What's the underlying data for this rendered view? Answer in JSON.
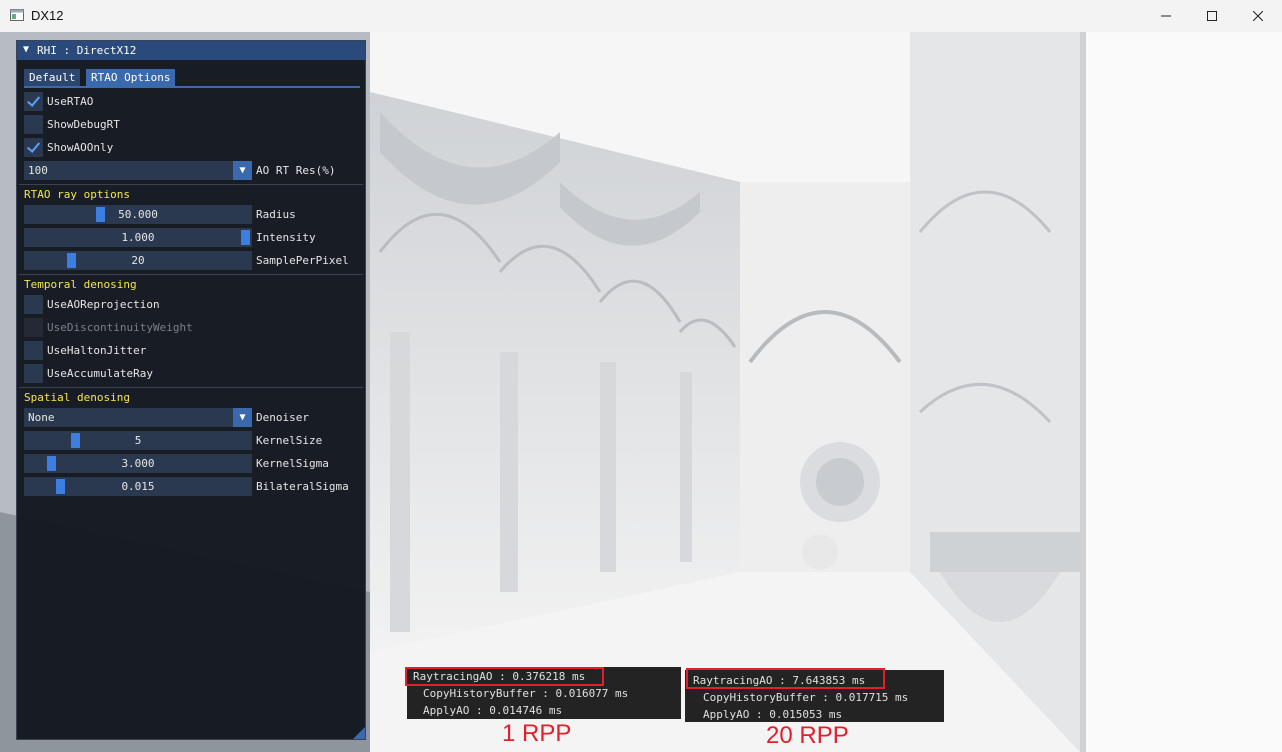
{
  "window": {
    "title": "DX12",
    "icon": "app-window-icon"
  },
  "panel": {
    "title": "RHI : DirectX12",
    "tabs": [
      "Default",
      "RTAO Options"
    ],
    "checkboxes_top": [
      {
        "label": "UseRTAO",
        "checked": true
      },
      {
        "label": "ShowDebugRT",
        "checked": false
      },
      {
        "label": "ShowAOOnly",
        "checked": true
      }
    ],
    "ao_res": {
      "value": "100",
      "label": "AO RT Res(%)"
    },
    "ray_section": "RTAO ray options",
    "ray_sliders": [
      {
        "value": "50.000",
        "label": "Radius",
        "fraction": 0.35
      },
      {
        "value": "1.000",
        "label": "Intensity",
        "fraction": 1.0
      },
      {
        "value": "20",
        "label": "SamplePerPixel",
        "fraction": 0.2
      }
    ],
    "temporal_section": "Temporal denosing",
    "temporal_checkboxes": [
      {
        "label": "UseAOReprojection",
        "checked": false,
        "disabled": false
      },
      {
        "label": "UseDiscontinuityWeight",
        "checked": false,
        "disabled": true
      },
      {
        "label": "UseHaltonJitter",
        "checked": false,
        "disabled": false
      },
      {
        "label": "UseAccumulateRay",
        "checked": false,
        "disabled": false
      }
    ],
    "spatial_section": "Spatial denosing",
    "denoiser": {
      "value": "None",
      "label": "Denoiser"
    },
    "spatial_sliders": [
      {
        "value": "5",
        "label": "KernelSize",
        "fraction": 0.23
      },
      {
        "value": "3.000",
        "label": "KernelSigma",
        "fraction": 0.1
      },
      {
        "value": "0.015",
        "label": "BilateralSigma",
        "fraction": 0.15
      }
    ]
  },
  "profiler_left": {
    "main": "RaytracingAO : 0.376218 ms",
    "lines": [
      "CopyHistoryBuffer : 0.016077 ms",
      "ApplyAO : 0.014746 ms"
    ],
    "caption": "1 RPP"
  },
  "profiler_right": {
    "main": "RaytracingAO : 7.643853 ms",
    "lines": [
      "CopyHistoryBuffer : 0.017715 ms",
      "ApplyAO : 0.015053 ms"
    ],
    "caption": "20 RPP"
  },
  "colors": {
    "highlight": "#e0202a",
    "section": "#f5e64b",
    "accent": "#3d7fe0"
  }
}
